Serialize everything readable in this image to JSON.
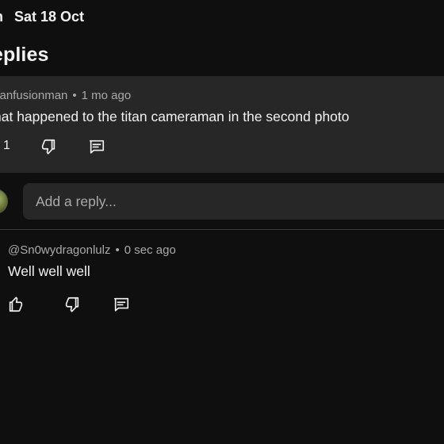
{
  "status_bar": {
    "time_fragment": "n",
    "date": "Sat 18 Oct"
  },
  "panel": {
    "title": "eplies"
  },
  "parent_comment": {
    "author": "itanfusionman",
    "separator": "•",
    "time_ago": "1 mo ago",
    "text": "hat happened to the titan cameraman in the second photo",
    "like_count": "1",
    "icons": [
      "thumbs-up-icon",
      "thumbs-down-icon",
      "reply-icon"
    ]
  },
  "reply_box": {
    "placeholder": "Add a reply...",
    "value": ""
  },
  "reply": {
    "author": "@Sn0wydragonlulz",
    "separator": "•",
    "time_ago": "0 sec ago",
    "text": "Well well well",
    "icons": [
      "thumbs-up-icon",
      "thumbs-down-icon",
      "reply-icon"
    ]
  },
  "colors": {
    "background": "#0f0f0f",
    "surface": "#272727",
    "text_primary": "#f1f1f1",
    "text_secondary": "#aaaaaa"
  }
}
